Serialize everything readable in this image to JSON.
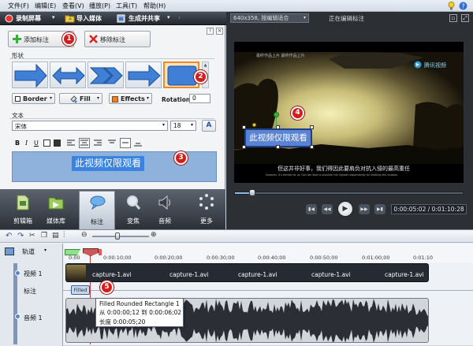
{
  "menu": [
    "文件(F)",
    "编辑(E)",
    "查看(V)",
    "播放(P)",
    "工具(T)",
    "帮助(H)"
  ],
  "toolbar": {
    "record": "录制屏幕",
    "import": "导入媒体",
    "produce": "生成并共享"
  },
  "callouts": {
    "add_button": "添加标注",
    "remove_button": "移除标注",
    "shape_label": "形状",
    "border_button": "Border",
    "fill_button": "Fill",
    "effects_button": "Effects",
    "rotation_label": "Rotation:",
    "rotation_value": "0",
    "text_label": "文本",
    "font_name": "宋体",
    "font_size": "18",
    "text_content": "此视频仅限观看"
  },
  "badges": [
    "1",
    "2",
    "3",
    "4",
    "5"
  ],
  "tabs": [
    "剪辑箱",
    "媒体库",
    "标注",
    "变焦",
    "音频",
    "更多"
  ],
  "preview": {
    "size_select": "640x358, 按编辑适合",
    "status": "正在编辑标注",
    "video_title_overlay": "最终作品上片 最终作品上片",
    "watermark": "腾讯视频",
    "callout_text": "此视频仅限观看",
    "subtitle_cn": "但这并非好事，我们得因此要肩负对抗入侵的最高重任",
    "subtitle_en": "However, it's terrible for us. Fact we have to shoulder the highest responsibility for resisting the invasion.",
    "time_display": "0:00:05:02 / 0:01:10:28"
  },
  "timeline": {
    "track_button": "轨道",
    "ruler_ticks": [
      "0:00",
      "0:00:10;00",
      "0:00:20;00",
      "0:00:30;00",
      "0:00:40;00",
      "0:00:50;00",
      "0:01:00;00",
      "0:01:10"
    ],
    "tracks": {
      "video": "视频 1",
      "callout": "标注",
      "audio": "音频 1"
    },
    "clip_label": "capture-1.avi",
    "callout_clip": "Filled",
    "tooltip": {
      "title": "Filled Rounded Rectangle 1",
      "range": "从 0:00:00;12 到 0:00:06;02",
      "duration": "长度 0:00:05;20"
    }
  }
}
